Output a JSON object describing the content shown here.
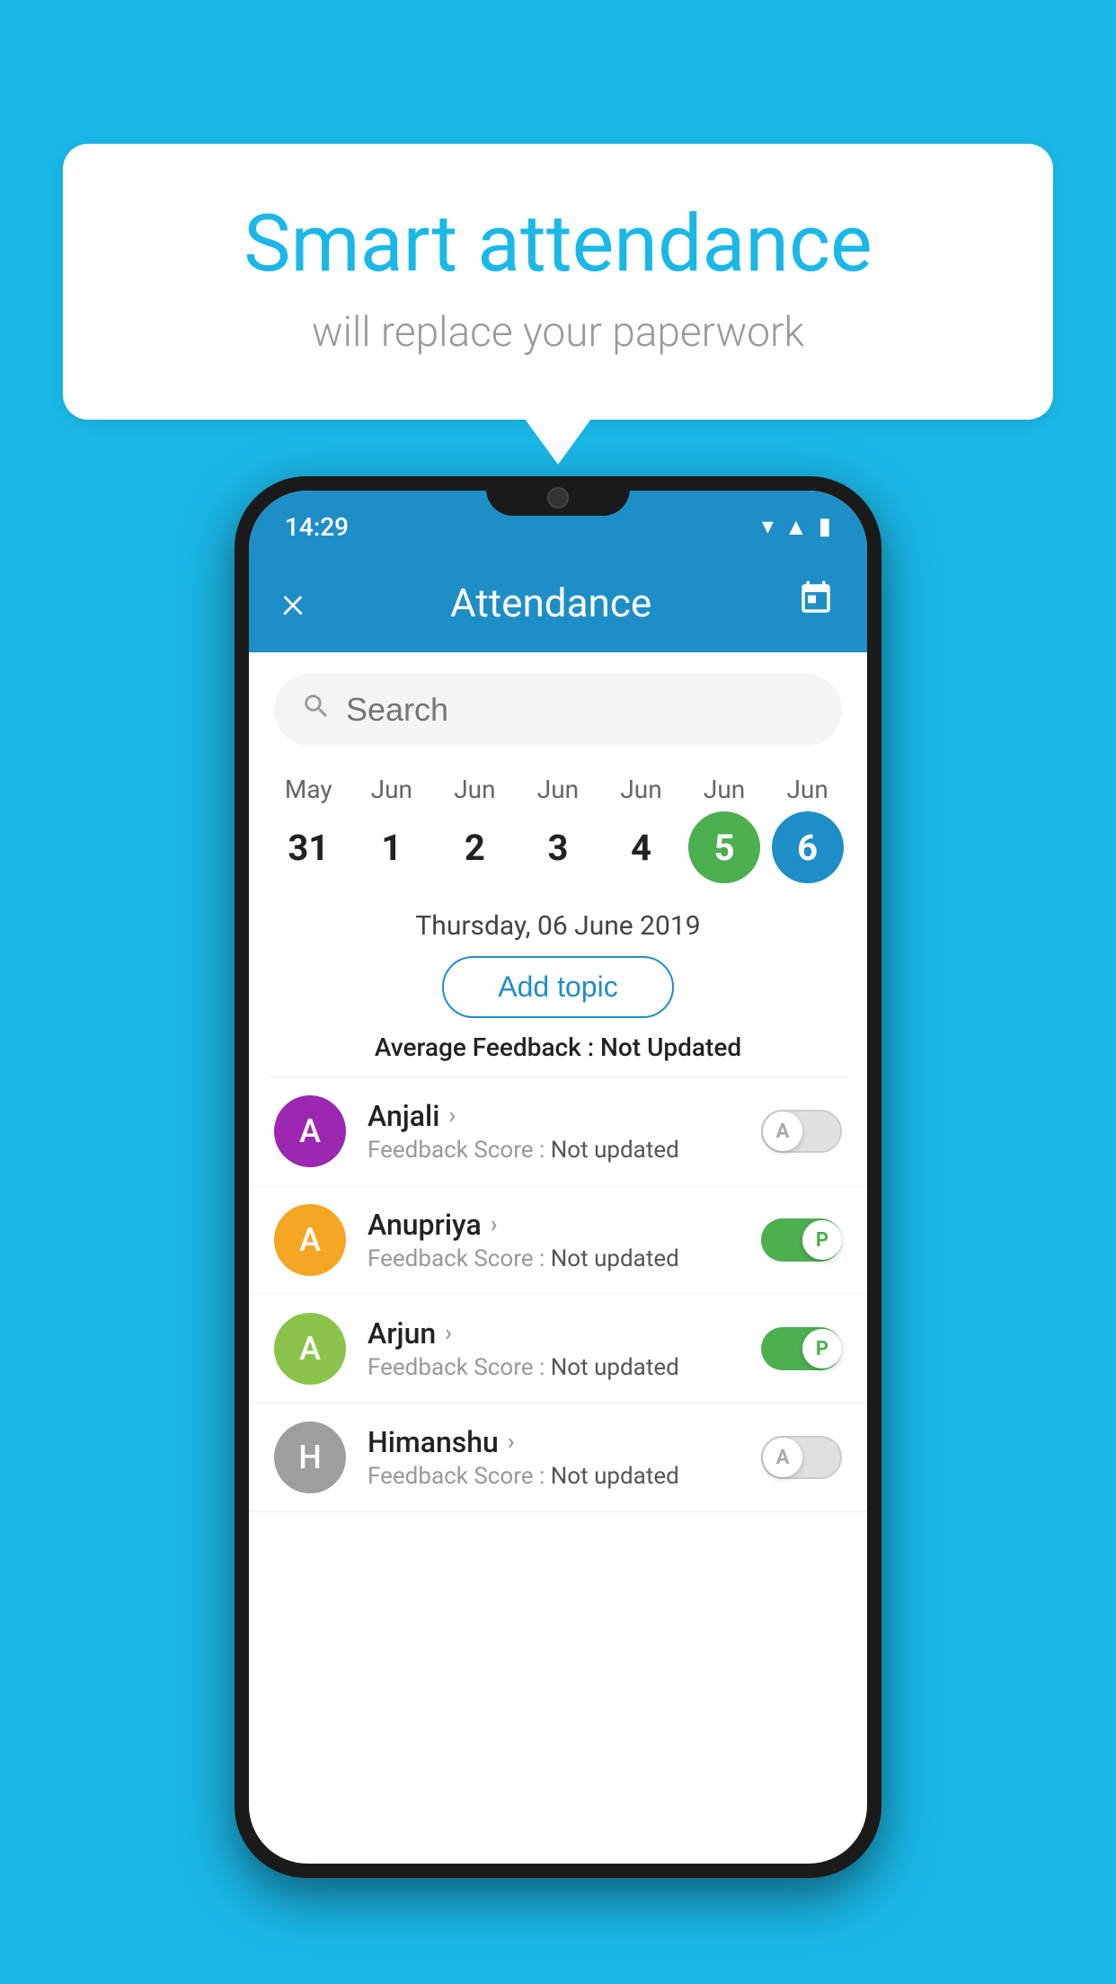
{
  "background_color": "#1ab8e8",
  "speech_bubble": {
    "title": "Smart attendance",
    "subtitle": "will replace your paperwork"
  },
  "status_bar": {
    "time": "14:29",
    "icons": [
      "wifi",
      "signal",
      "battery"
    ]
  },
  "header": {
    "title": "Attendance",
    "close_label": "×",
    "calendar_label": "📅"
  },
  "search": {
    "placeholder": "Search"
  },
  "calendar": {
    "months": [
      "May",
      "Jun",
      "Jun",
      "Jun",
      "Jun",
      "Jun",
      "Jun"
    ],
    "dates": [
      "31",
      "1",
      "2",
      "3",
      "4",
      "5",
      "6"
    ],
    "today_index": 5,
    "selected_index": 6
  },
  "selected_date": "Thursday, 06 June 2019",
  "add_topic_label": "Add topic",
  "average_feedback": {
    "label": "Average Feedback :",
    "value": "Not Updated"
  },
  "students": [
    {
      "name": "Anjali",
      "avatar_letter": "A",
      "avatar_color": "#9c27b0",
      "feedback_label": "Feedback Score :",
      "feedback_value": "Not updated",
      "toggle_state": "off",
      "toggle_label": "A"
    },
    {
      "name": "Anupriya",
      "avatar_letter": "A",
      "avatar_color": "#f5a623",
      "feedback_label": "Feedback Score :",
      "feedback_value": "Not updated",
      "toggle_state": "on",
      "toggle_label": "P"
    },
    {
      "name": "Arjun",
      "avatar_letter": "A",
      "avatar_color": "#8bc34a",
      "feedback_label": "Feedback Score :",
      "feedback_value": "Not updated",
      "toggle_state": "on",
      "toggle_label": "P"
    },
    {
      "name": "Himanshu",
      "avatar_letter": "H",
      "avatar_color": "#9e9e9e",
      "feedback_label": "Feedback Score :",
      "feedback_value": "Not updated",
      "toggle_state": "off",
      "toggle_label": "A"
    }
  ]
}
